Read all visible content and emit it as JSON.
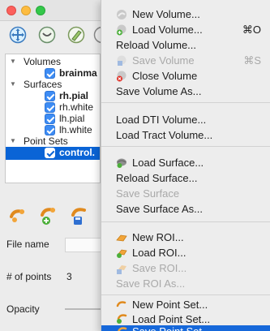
{
  "window": {
    "traffic_lights": {
      "close": "#fc605c",
      "minimize": "#fdbc40",
      "zoom": "#34c84a"
    },
    "toolbar_icons": [
      "navigate-icon",
      "zoom-icon",
      "recon-edit-icon"
    ]
  },
  "layer_tree": {
    "groups": [
      {
        "label": "Volumes",
        "items": [
          {
            "label": "brainma",
            "bold": true,
            "checked": true
          }
        ]
      },
      {
        "label": "Surfaces",
        "items": [
          {
            "label": "rh.pial",
            "bold": true,
            "checked": true
          },
          {
            "label": "rh.white",
            "bold": false,
            "checked": true
          },
          {
            "label": "lh.pial",
            "bold": false,
            "checked": true
          },
          {
            "label": "lh.white",
            "bold": false,
            "checked": true
          }
        ]
      },
      {
        "label": "Point Sets",
        "items": [
          {
            "label": "control.",
            "bold": true,
            "checked": true,
            "selected": true
          }
        ]
      }
    ]
  },
  "pointset_panel": {
    "icons": [
      "new-pointset-icon",
      "load-pointset-icon",
      "save-pointset-icon"
    ],
    "file_name_label": "File name",
    "file_name_value": "",
    "num_points_label": "# of points",
    "num_points_value": "3",
    "opacity_label": "Opacity"
  },
  "file_menu": {
    "new_volume": {
      "label": "New Volume...",
      "shortcut": "",
      "enabled": true
    },
    "load_volume": {
      "label": "Load Volume...",
      "shortcut": "⌘O",
      "enabled": true
    },
    "reload_volume": {
      "label": "Reload Volume...",
      "shortcut": "",
      "enabled": true
    },
    "save_volume": {
      "label": "Save Volume",
      "shortcut": "⌘S",
      "enabled": false
    },
    "close_volume": {
      "label": "Close Volume",
      "shortcut": "",
      "enabled": true
    },
    "save_volume_as": {
      "label": "Save Volume As...",
      "shortcut": "",
      "enabled": true
    },
    "load_dti_volume": {
      "label": "Load DTI Volume...",
      "shortcut": "",
      "enabled": true
    },
    "load_tract_volume": {
      "label": "Load Tract Volume...",
      "shortcut": "",
      "enabled": true
    },
    "load_surface": {
      "label": "Load Surface...",
      "shortcut": "",
      "enabled": true
    },
    "reload_surface": {
      "label": "Reload Surface...",
      "shortcut": "",
      "enabled": true
    },
    "save_surface": {
      "label": "Save Surface",
      "shortcut": "",
      "enabled": false
    },
    "save_surface_as": {
      "label": "Save Surface As...",
      "shortcut": "",
      "enabled": true
    },
    "new_roi": {
      "label": "New ROI...",
      "shortcut": "",
      "enabled": true
    },
    "load_roi": {
      "label": "Load ROI...",
      "shortcut": "",
      "enabled": true
    },
    "save_roi": {
      "label": "Save ROI...",
      "shortcut": "",
      "enabled": false
    },
    "save_roi_as": {
      "label": "Save ROI As...",
      "shortcut": "",
      "enabled": false
    },
    "new_point_set": {
      "label": "New Point Set...",
      "shortcut": "",
      "enabled": true
    },
    "load_point_set": {
      "label": "Load Point Set...",
      "shortcut": "",
      "enabled": true
    },
    "save_point_set": {
      "label": "Save Point Set",
      "shortcut": "",
      "enabled": true,
      "highlighted": true
    }
  },
  "colors": {
    "menu_highlight": "#1668da",
    "selection": "#0a64d6",
    "checkbox": "#3d8cf4"
  }
}
